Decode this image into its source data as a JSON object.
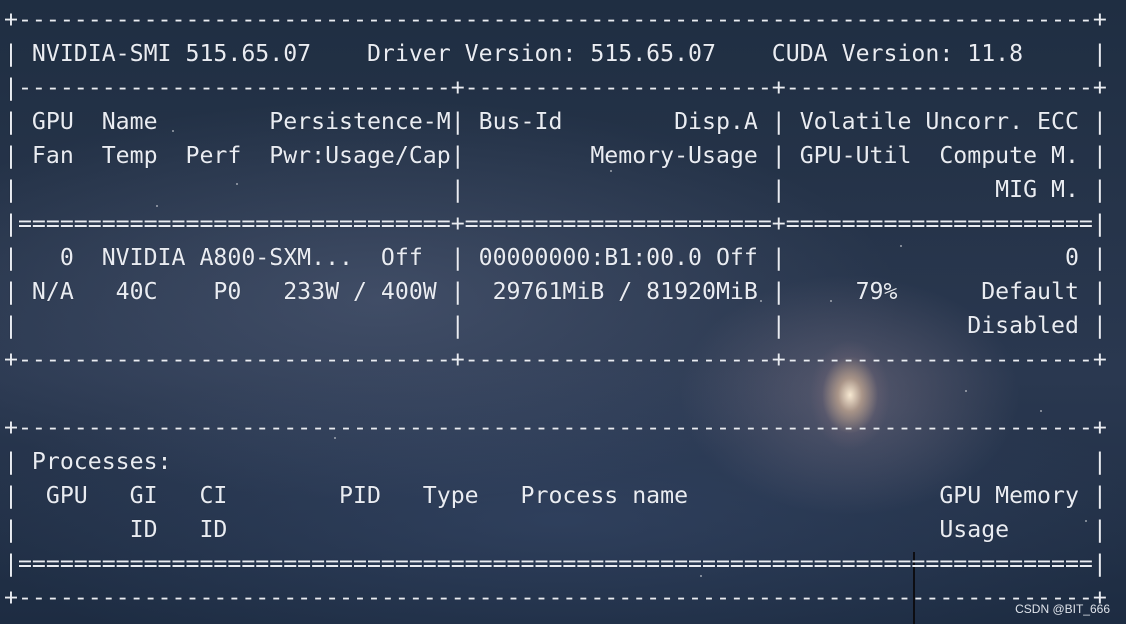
{
  "terminal": {
    "lines": [
      "+-----------------------------------------------------------------------------+",
      "| NVIDIA-SMI 515.65.07    Driver Version: 515.65.07    CUDA Version: 11.8     |",
      "|-------------------------------+----------------------+----------------------+",
      "| GPU  Name        Persistence-M| Bus-Id        Disp.A | Volatile Uncorr. ECC |",
      "| Fan  Temp  Perf  Pwr:Usage/Cap|         Memory-Usage | GPU-Util  Compute M. |",
      "|                               |                      |               MIG M. |",
      "|===============================+======================+======================|",
      "|   0  NVIDIA A800-SXM...  Off  | 00000000:B1:00.0 Off |                    0 |",
      "| N/A   40C    P0   233W / 400W |  29761MiB / 81920MiB |     79%      Default |",
      "|                               |                      |             Disabled |",
      "+-------------------------------+----------------------+----------------------+",
      "",
      "+-----------------------------------------------------------------------------+",
      "| Processes:                                                                  |",
      "|  GPU   GI   CI        PID   Type   Process name                  GPU Memory |",
      "|        ID   ID                                                   Usage      |",
      "|=============================================================================|",
      "+-----------------------------------------------------------------------------+"
    ]
  },
  "watermark": "CSDN @BIT_666"
}
